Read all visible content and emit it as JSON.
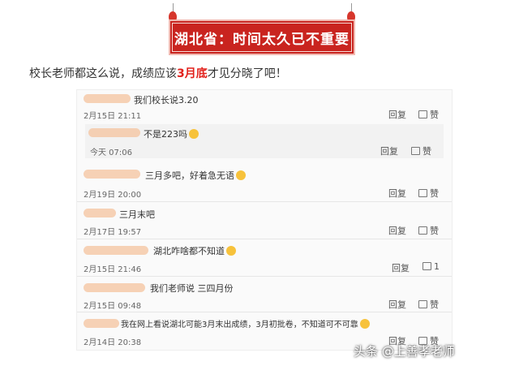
{
  "banner": {
    "title": "湖北省：时间太久已不重要"
  },
  "lead": {
    "before": "校长老师都这么说，成绩应该",
    "emphasis": "3月底",
    "after": "才见分晓了吧！"
  },
  "actions": {
    "reply": "回复",
    "like": "赞"
  },
  "comments": [
    {
      "text": "我们校长说3.20",
      "time": "2月15日 21:11",
      "likes": ""
    },
    {
      "text": "不是223吗",
      "time": "今天 07:06",
      "likes": ""
    },
    {
      "text": "三月多吧，好着急无语",
      "time": "2月19日 20:00",
      "likes": ""
    },
    {
      "text": "三月末吧",
      "time": "2月17日 19:57",
      "likes": ""
    },
    {
      "text": "湖北咋啥都不知道",
      "time": "2月15日 21:46",
      "likes": "1"
    },
    {
      "text": "我们老师说 三四月份",
      "time": "2月15日 09:48",
      "likes": ""
    },
    {
      "text": "我在网上看说湖北可能3月末出成绩，3月初批卷，不知道可不可靠",
      "time": "2月14日 20:38",
      "likes": ""
    }
  ],
  "watermark": "头条 @上善孝老师"
}
